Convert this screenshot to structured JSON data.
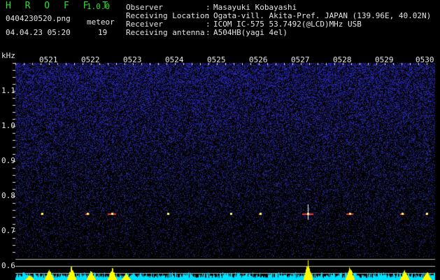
{
  "app": {
    "name": "H R O F F T",
    "version": "1.0.0"
  },
  "file": {
    "name": "0404230520.png",
    "timestamp": "04.04.23 05:20"
  },
  "meteor": {
    "label": "meteor",
    "count": "19"
  },
  "info": [
    {
      "label": "Observer",
      "value": "Masayuki Kobayashi"
    },
    {
      "label": "Receiving Location",
      "value": "Ogata-vill. Akita-Pref. JAPAN (139.96E, 40.02N)"
    },
    {
      "label": "Receiver",
      "value": "ICOM IC-575 53.7492(@LCD)MHz USB"
    },
    {
      "label": "Receiving antenna",
      "value": "A504HB(yagi 4el)"
    }
  ],
  "axis": {
    "unit": "kHz",
    "time_ticks": [
      "0521",
      "0522",
      "0523",
      "0524",
      "0525",
      "0526",
      "0527",
      "0528",
      "0529",
      "0530"
    ],
    "freq_ticks": [
      "1.1",
      "1.0",
      "0.9",
      "0.8",
      "0.7",
      "0.6"
    ]
  },
  "colors": {
    "background": "#000000",
    "text": "#e6e6e6",
    "title": "#2ee02e",
    "noise": "#2a2a9a",
    "meteor": "#ffffff",
    "spectrum": "#ffff00",
    "spectrum_base": "#00ffff"
  }
}
